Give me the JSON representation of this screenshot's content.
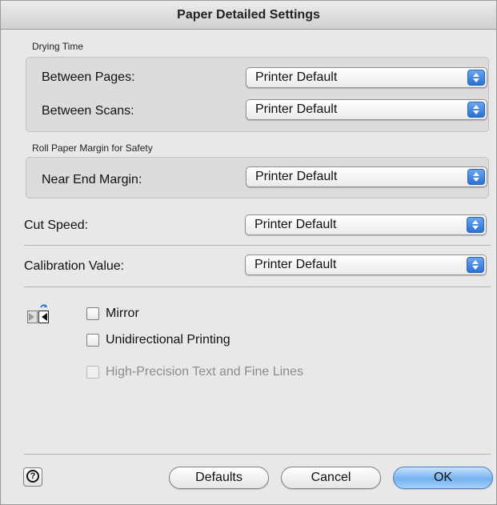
{
  "window": {
    "title": "Paper Detailed Settings"
  },
  "drying_time": {
    "caption": "Drying Time",
    "between_pages": {
      "label": "Between Pages:",
      "value": "Printer Default"
    },
    "between_scans": {
      "label": "Between Scans:",
      "value": "Printer Default"
    }
  },
  "roll_margin": {
    "caption": "Roll Paper Margin for Safety",
    "near_end": {
      "label": "Near End Margin:",
      "value": "Printer Default"
    }
  },
  "cut_speed": {
    "label": "Cut Speed:",
    "value": "Printer Default"
  },
  "calibration": {
    "label": "Calibration Value:",
    "value": "Printer Default"
  },
  "options": {
    "mirror": {
      "label": "Mirror",
      "checked": false
    },
    "unidirectional": {
      "label": "Unidirectional Printing",
      "checked": false
    },
    "high_precision": {
      "label": "High-Precision Text and Fine Lines",
      "checked": false,
      "enabled": false
    }
  },
  "footer": {
    "help_glyph": "?",
    "defaults_label": "Defaults",
    "cancel_label": "Cancel",
    "ok_label": "OK"
  },
  "colors": {
    "accent": "#2a6fd6",
    "window_bg": "#e8e8e8"
  },
  "icons": {
    "help": "question-mark-icon",
    "popup_arrows": "up-down-arrows-icon",
    "mirror": "mirror-icon"
  }
}
